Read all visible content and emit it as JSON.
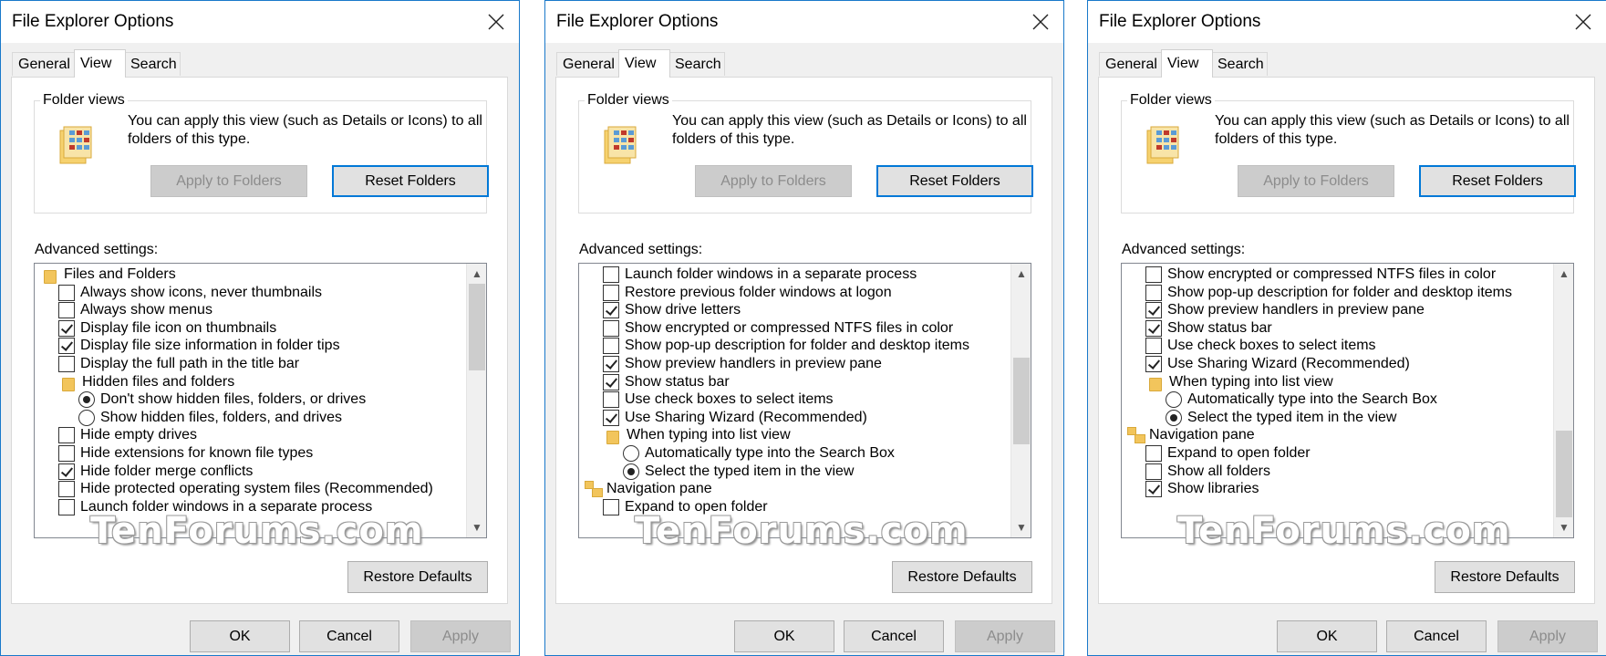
{
  "dialog": {
    "title": "File Explorer Options",
    "tabs": [
      "General",
      "View",
      "Search"
    ],
    "folder_views": {
      "label": "Folder views",
      "description": "You can apply this view (such as Details or Icons) to all folders of this type.",
      "apply_label": "Apply to Folders",
      "reset_label": "Reset Folders"
    },
    "advanced_label": "Advanced settings:",
    "restore_label": "Restore Defaults",
    "ok_label": "OK",
    "cancel_label": "Cancel",
    "apply_label": "Apply",
    "watermark": "TenForums.com"
  },
  "views": [
    {
      "items": [
        {
          "type": "folder",
          "label": "Files and Folders"
        },
        {
          "type": "checkbox",
          "checked": false,
          "label": "Always show icons, never thumbnails"
        },
        {
          "type": "checkbox",
          "checked": false,
          "label": "Always show menus"
        },
        {
          "type": "checkbox",
          "checked": true,
          "label": "Display file icon on thumbnails"
        },
        {
          "type": "checkbox",
          "checked": true,
          "label": "Display file size information in folder tips"
        },
        {
          "type": "checkbox",
          "checked": false,
          "label": "Display the full path in the title bar"
        },
        {
          "type": "subfolder",
          "label": "Hidden files and folders"
        },
        {
          "type": "radio",
          "checked": true,
          "label": "Don't show hidden files, folders, or drives"
        },
        {
          "type": "radio",
          "checked": false,
          "label": "Show hidden files, folders, and drives"
        },
        {
          "type": "checkbox",
          "checked": false,
          "label": "Hide empty drives"
        },
        {
          "type": "checkbox",
          "checked": false,
          "label": "Hide extensions for known file types"
        },
        {
          "type": "checkbox",
          "checked": true,
          "label": "Hide folder merge conflicts"
        },
        {
          "type": "checkbox",
          "checked": false,
          "label": "Hide protected operating system files (Recommended)"
        },
        {
          "type": "checkbox",
          "checked": false,
          "label": "Launch folder windows in a separate process"
        }
      ],
      "scroll": 0.0
    },
    {
      "items": [
        {
          "type": "checkbox",
          "checked": false,
          "label": "Launch folder windows in a separate process"
        },
        {
          "type": "checkbox",
          "checked": false,
          "label": "Restore previous folder windows at logon"
        },
        {
          "type": "checkbox",
          "checked": true,
          "label": "Show drive letters"
        },
        {
          "type": "checkbox",
          "checked": false,
          "label": "Show encrypted or compressed NTFS files in color"
        },
        {
          "type": "checkbox",
          "checked": false,
          "label": "Show pop-up description for folder and desktop items"
        },
        {
          "type": "checkbox",
          "checked": true,
          "label": "Show preview handlers in preview pane"
        },
        {
          "type": "checkbox",
          "checked": true,
          "label": "Show status bar"
        },
        {
          "type": "checkbox",
          "checked": false,
          "label": "Use check boxes to select items"
        },
        {
          "type": "checkbox",
          "checked": true,
          "label": "Use Sharing Wizard (Recommended)"
        },
        {
          "type": "subfolder",
          "label": "When typing into list view"
        },
        {
          "type": "radio",
          "checked": false,
          "label": "Automatically type into the Search Box"
        },
        {
          "type": "radio",
          "checked": true,
          "label": "Select the typed item in the view"
        },
        {
          "type": "navpane",
          "label": "Navigation pane"
        },
        {
          "type": "checkbox",
          "checked": false,
          "label": "Expand to open folder"
        }
      ],
      "scroll": 0.5
    },
    {
      "items": [
        {
          "type": "checkbox",
          "checked": false,
          "label": "Show encrypted or compressed NTFS files in color"
        },
        {
          "type": "checkbox",
          "checked": false,
          "label": "Show pop-up description for folder and desktop items"
        },
        {
          "type": "checkbox",
          "checked": true,
          "label": "Show preview handlers in preview pane"
        },
        {
          "type": "checkbox",
          "checked": true,
          "label": "Show status bar"
        },
        {
          "type": "checkbox",
          "checked": false,
          "label": "Use check boxes to select items"
        },
        {
          "type": "checkbox",
          "checked": true,
          "label": "Use Sharing Wizard (Recommended)"
        },
        {
          "type": "subfolder",
          "label": "When typing into list view"
        },
        {
          "type": "radio",
          "checked": false,
          "label": "Automatically type into the Search Box"
        },
        {
          "type": "radio",
          "checked": true,
          "label": "Select the typed item in the view"
        },
        {
          "type": "navpane",
          "label": "Navigation pane"
        },
        {
          "type": "checkbox",
          "checked": false,
          "label": "Expand to open folder"
        },
        {
          "type": "checkbox",
          "checked": false,
          "label": "Show all folders"
        },
        {
          "type": "checkbox",
          "checked": true,
          "label": "Show libraries"
        }
      ],
      "scroll": 1.0
    }
  ]
}
